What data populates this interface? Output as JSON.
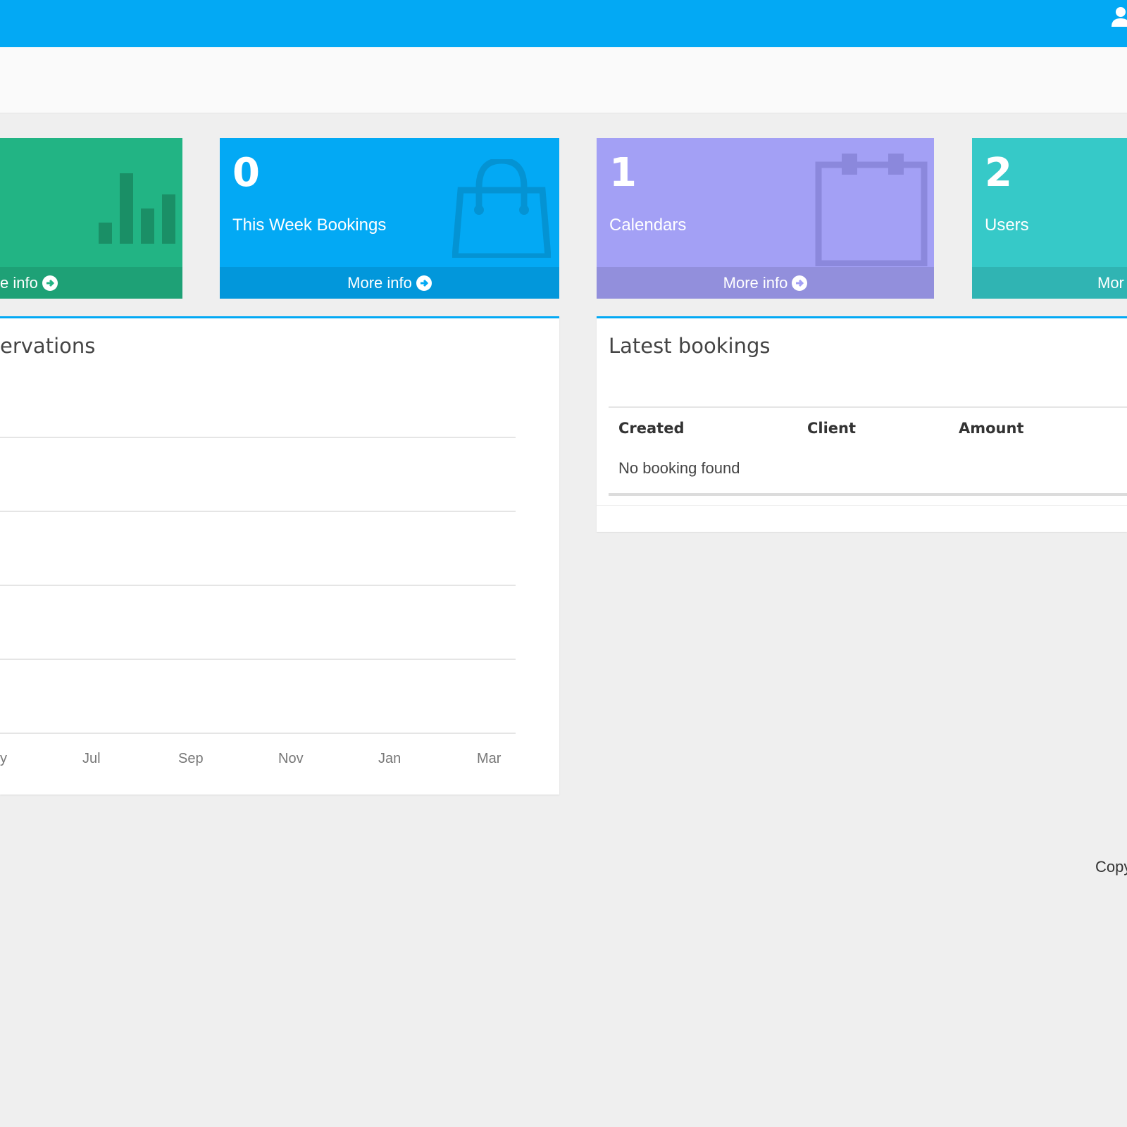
{
  "header": {
    "user_icon": "user-icon"
  },
  "boxes": [
    {
      "id": "sales",
      "value": "",
      "label": "",
      "more": "e info",
      "color": "#22b484",
      "icon": "bar-chart-icon"
    },
    {
      "id": "week",
      "value": "0",
      "label": "This Week Bookings",
      "more": "More info",
      "color": "#03a9f4",
      "icon": "shopping-bag-icon"
    },
    {
      "id": "calendars",
      "value": "1",
      "label": "Calendars",
      "more": "More info",
      "color": "#a3a0f5",
      "icon": "calendar-icon"
    },
    {
      "id": "users",
      "value": "2",
      "label": "Users",
      "more": "Mor",
      "color": "#36c9c8",
      "icon": "user-plus-icon"
    }
  ],
  "reservations": {
    "title": "ervations",
    "x_ticks": [
      "y",
      "Jul",
      "Sep",
      "Nov",
      "Jan",
      "Mar"
    ]
  },
  "latest_bookings": {
    "title": "Latest bookings",
    "columns": [
      "Created",
      "Client",
      "Amount"
    ],
    "empty_message": "No booking found"
  },
  "footer": {
    "copyright": "Copy"
  }
}
